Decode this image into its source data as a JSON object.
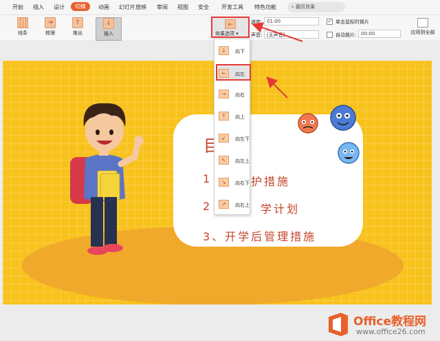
{
  "menu": {
    "tabs": [
      "开始",
      "插入",
      "设计",
      "切换",
      "动画",
      "幻灯片放映",
      "审阅",
      "视图",
      "安全",
      "开发工具",
      "特色功能"
    ],
    "active_tab": "切换",
    "search_placeholder": "翻页效果"
  },
  "ribbon": {
    "transitions": [
      {
        "label": "线条",
        "icon": "lines-transition-icon"
      },
      {
        "label": "梳理",
        "icon": "comb-transition-icon"
      },
      {
        "label": "推出",
        "icon": "push-transition-icon"
      },
      {
        "label": "插入",
        "icon": "cover-transition-icon"
      }
    ],
    "selected_transition": "插入",
    "effect_options_label": "效果选项",
    "speed_label": "速度:",
    "speed_value": "01.00",
    "sound_label": "声音:",
    "sound_value": "[无声音]",
    "on_click_label": "单击鼠标时换片",
    "on_click_checked": true,
    "auto_advance_label": "自动换片:",
    "auto_advance_checked": false,
    "auto_advance_value": "00:00",
    "apply_all_label": "应用到全部"
  },
  "dropdown": {
    "items": [
      {
        "label": "向下",
        "glyph": "↓"
      },
      {
        "label": "向左",
        "glyph": "←"
      },
      {
        "label": "向右",
        "glyph": "→"
      },
      {
        "label": "向上",
        "glyph": "↑"
      },
      {
        "label": "向左下",
        "glyph": "↙"
      },
      {
        "label": "向左上",
        "glyph": "↖"
      },
      {
        "label": "向右下",
        "glyph": "↘"
      },
      {
        "label": "向右上",
        "glyph": "↗"
      }
    ],
    "selected": "向左"
  },
  "slide": {
    "title_partial": "目",
    "items": [
      "1",
      "护措施",
      "2",
      "学计划",
      "3、开学后管理措施"
    ]
  },
  "watermark": {
    "line1": "Office教程网",
    "line2": "www.office26.com"
  },
  "colors": {
    "accent": "#e8602c",
    "highlight": "#e53935",
    "slide_bg": "#f8c21c",
    "slide_text": "#c6432d"
  }
}
